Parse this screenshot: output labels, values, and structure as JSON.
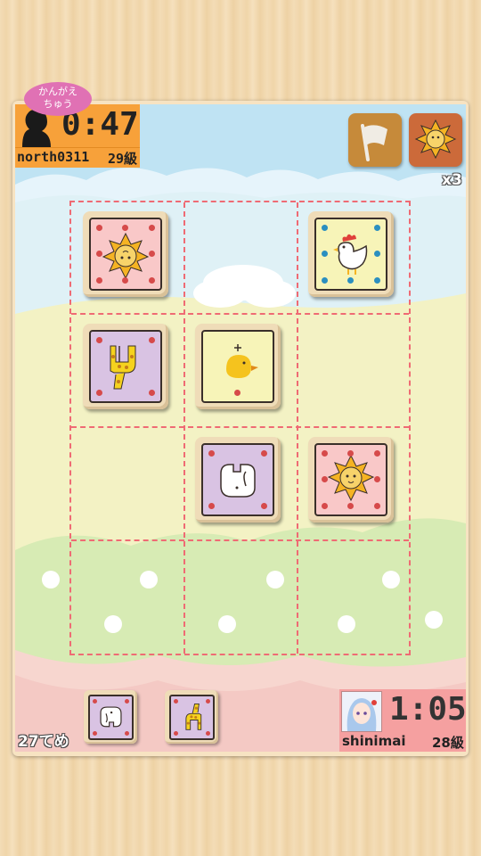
{
  "opponent": {
    "status_bubble": "かんがえ\nちゅう",
    "time": "0:47",
    "name": "north0311",
    "rank": "29級",
    "avatar_icon": "silhouette-avatar-icon"
  },
  "buttons": {
    "resign_icon": "white-flag-icon",
    "lion_icon": "lion-icon",
    "lion_count": "x3"
  },
  "board": {
    "rows": 4,
    "cols": 3,
    "pieces": [
      {
        "row": 0,
        "col": 0,
        "animal": "lion",
        "owner": "opponent",
        "color": "#f9c8c8"
      },
      {
        "row": 0,
        "col": 2,
        "animal": "chicken",
        "owner": "opponent",
        "color": "#f7f4b8"
      },
      {
        "row": 1,
        "col": 0,
        "animal": "giraffe",
        "owner": "opponent",
        "color": "#d9c3e3"
      },
      {
        "row": 1,
        "col": 1,
        "animal": "chick",
        "owner": "player",
        "color": "#f7f4b8"
      },
      {
        "row": 2,
        "col": 1,
        "animal": "elephant",
        "owner": "opponent",
        "color": "#d9c3e3"
      },
      {
        "row": 2,
        "col": 2,
        "animal": "lion",
        "owner": "player",
        "color": "#f9c8c8"
      }
    ]
  },
  "player_hand": [
    "elephant",
    "giraffe"
  ],
  "player": {
    "time": "1:05",
    "name": "shinimai",
    "rank": "28級",
    "avatar_icon": "anime-girl-avatar-icon"
  },
  "move_counter": "27てめ"
}
